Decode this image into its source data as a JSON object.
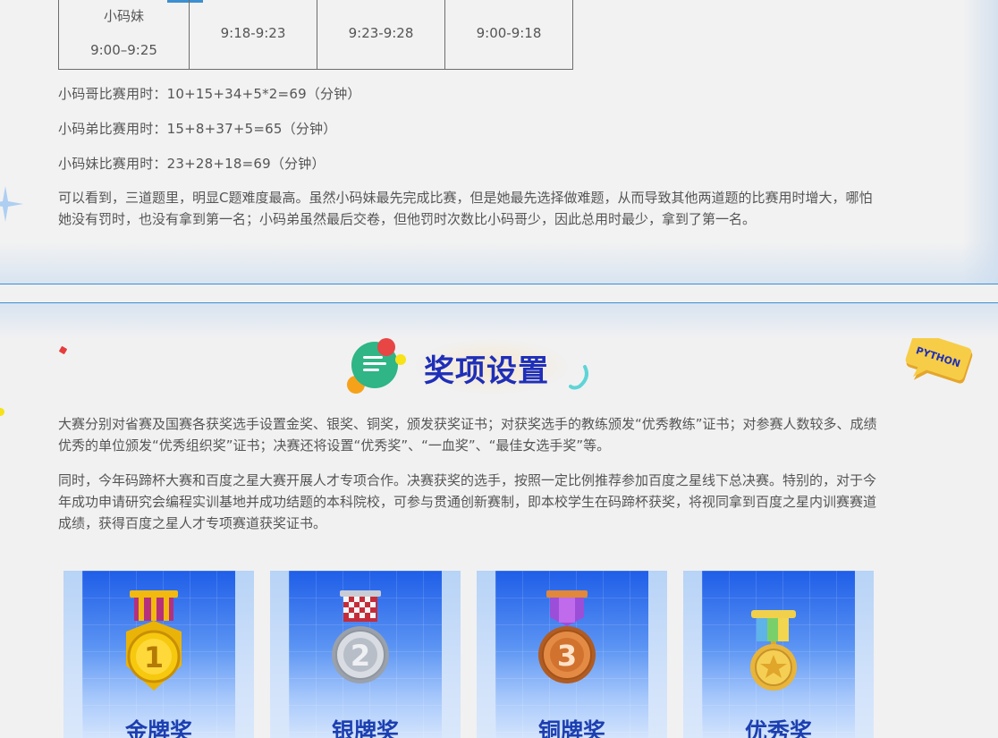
{
  "schedule_table": {
    "row": [
      {
        "name": "小码妹",
        "time": "9:00–9:25"
      },
      {
        "time": "9:18-9:23"
      },
      {
        "time": "9:23-9:28"
      },
      {
        "time": "9:00-9:18"
      }
    ]
  },
  "results": {
    "line1": "小码哥比赛用时：10+15+34+5*2=69（分钟）",
    "line2": "小码弟比赛用时：15+8+37+5=65（分钟）",
    "line3": "小码妹比赛用时：23+28+18=69（分钟）",
    "analysis": "可以看到，三道题里，明显C题难度最高。虽然小码妹最先完成比赛，但是她最先选择做难题，从而导致其他两道题的比赛用时增大，哪怕她没有罚时，也没有拿到第一名；小码弟虽然最后交卷，但他罚时次数比小码哥少，因此总用时最少，拿到了第一名。"
  },
  "awards": {
    "title": "奖项设置",
    "badge_text": "PYTHON",
    "para1": "大赛分别对省赛及国赛各获奖选手设置金奖、银奖、铜奖，颁发获奖证书；对获奖选手的教练颁发“优秀教练”证书；对参赛人数较多、成绩优秀的单位颁发“优秀组织奖”证书；决赛还将设置“优秀奖”、“一血奖”、“最佳女选手奖”等。",
    "para2": "同时，今年码蹄杯大赛和百度之星大赛开展人才专项合作。决赛获奖的选手，按照一定比例推荐参加百度之星线下总决赛。特别的，对于今年成功申请研究会编程实训基地并成功结题的本科院校，可参与贯通创新赛制，即本校学生在码蹄杯获奖，将视同拿到百度之星内训赛赛道成绩，获得百度之星人才专项赛道获奖证书。",
    "cards": [
      {
        "label": "金牌奖",
        "number": "1",
        "icon": "gold-medal-icon"
      },
      {
        "label": "银牌奖",
        "number": "2",
        "icon": "silver-medal-icon"
      },
      {
        "label": "铜牌奖",
        "number": "3",
        "icon": "bronze-medal-icon"
      },
      {
        "label": "优秀奖",
        "icon": "excellence-medal-icon"
      }
    ]
  },
  "colors": {
    "title": "#1f2fb8",
    "divider": "#3b8ed4",
    "card_blue": "#1f5ee8"
  }
}
